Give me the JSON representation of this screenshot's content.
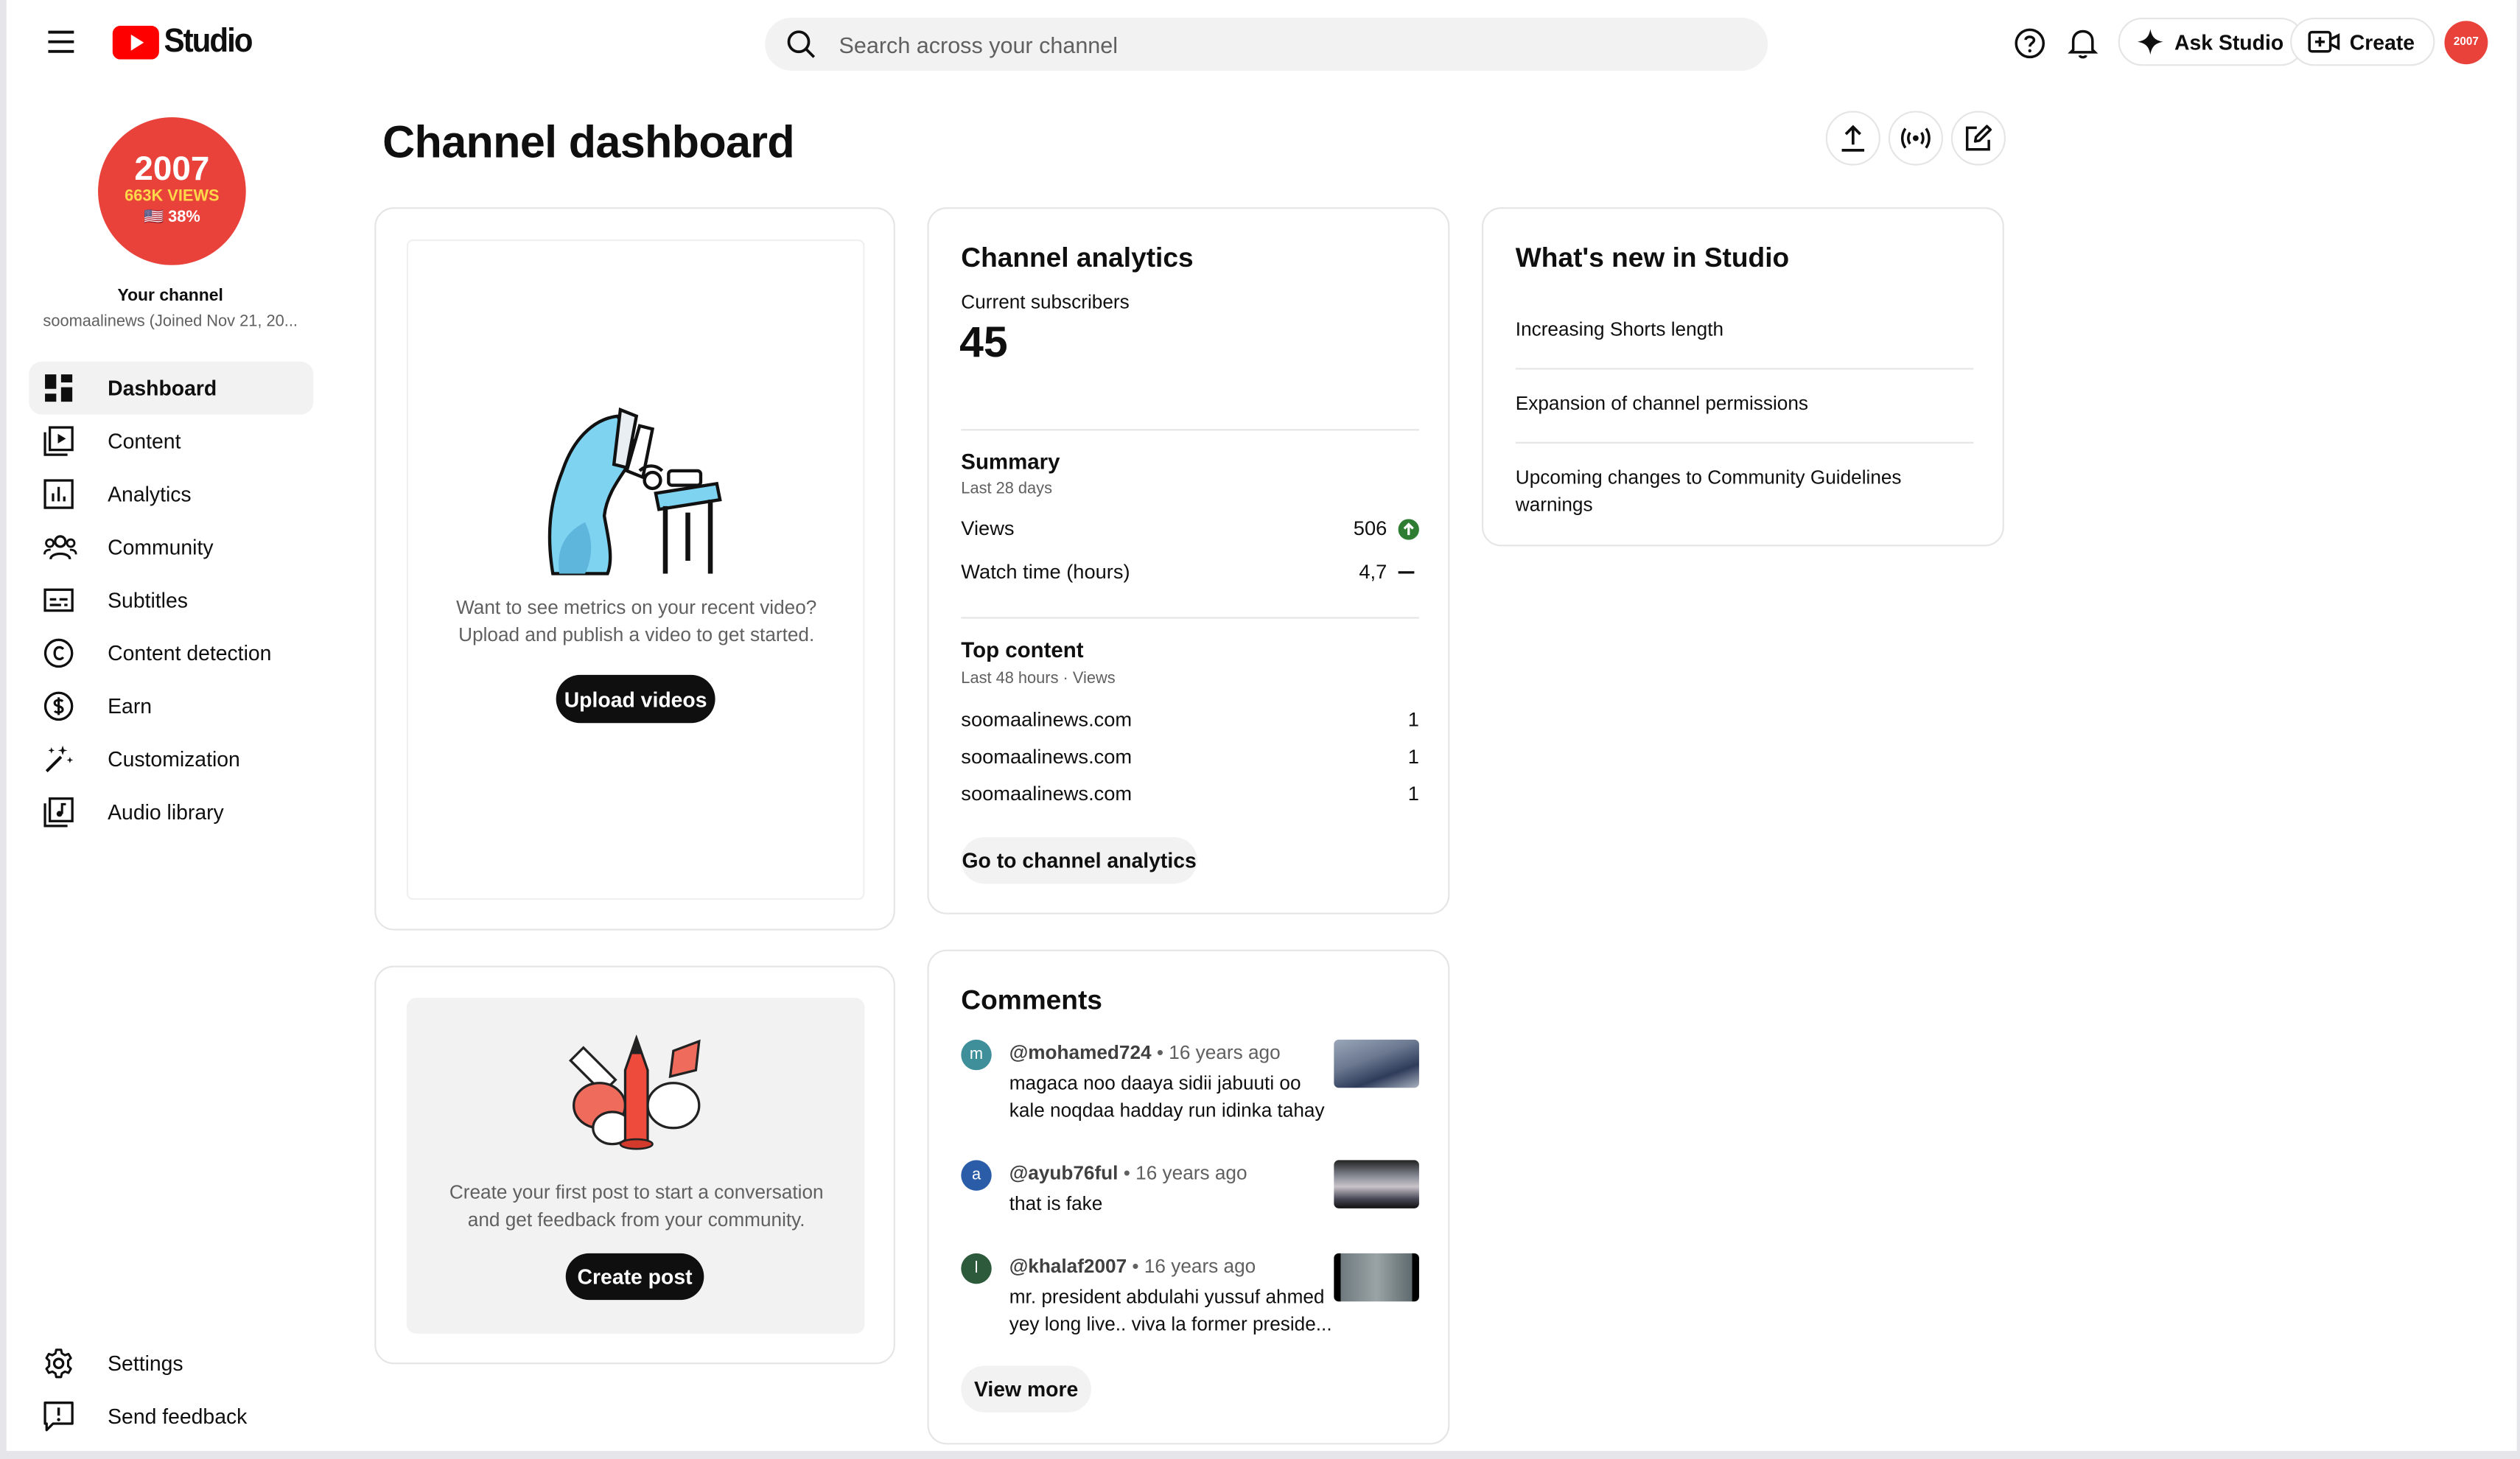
{
  "header": {
    "logo_text": "Studio",
    "search_placeholder": "Search across your channel",
    "ask_studio_label": "Ask Studio",
    "create_label": "Create",
    "avatar_text": "2007"
  },
  "channel": {
    "avatar_big_text": "2007",
    "avatar_views_text": "663K VIEWS",
    "avatar_percent_text": "🇺🇸 38%",
    "your_channel_label": "Your channel",
    "handle": "soomaalinews (Joined Nov 21, 20..."
  },
  "sidebar": {
    "items": [
      {
        "label": "Dashboard"
      },
      {
        "label": "Content"
      },
      {
        "label": "Analytics"
      },
      {
        "label": "Community"
      },
      {
        "label": "Subtitles"
      },
      {
        "label": "Content detection"
      },
      {
        "label": "Earn"
      },
      {
        "label": "Customization"
      },
      {
        "label": "Audio library"
      }
    ],
    "settings_label": "Settings",
    "feedback_label": "Send feedback"
  },
  "page": {
    "title": "Channel dashboard"
  },
  "upload_card": {
    "message_line1": "Want to see metrics on your recent video?",
    "message_line2": "Upload and publish a video to get started.",
    "button_label": "Upload videos"
  },
  "post_card": {
    "message_line1": "Create your first post to start a conversation",
    "message_line2": "and get feedback from your community.",
    "button_label": "Create post"
  },
  "analytics": {
    "title": "Channel analytics",
    "subscribers_label": "Current subscribers",
    "subscribers_value": "45",
    "summary_title": "Summary",
    "summary_period": "Last 28 days",
    "views_label": "Views",
    "views_value": "506",
    "watch_label": "Watch time (hours)",
    "watch_value": "4,7",
    "top_title": "Top content",
    "top_period": "Last 48 hours · Views",
    "top_items": [
      {
        "name": "soomaalinews.com",
        "value": "1"
      },
      {
        "name": "soomaalinews.com",
        "value": "1"
      },
      {
        "name": "soomaalinews.com",
        "value": "1"
      }
    ],
    "button_label": "Go to channel analytics"
  },
  "comments": {
    "title": "Comments",
    "items": [
      {
        "initial": "m",
        "color": "#3f8f9a",
        "user": "@mohamed724",
        "time": "• 16 years ago",
        "line1": "magaca noo daaya sidii jabuuti oo",
        "line2": "kale noqdaa hadday run idinka tahay"
      },
      {
        "initial": "a",
        "color": "#2a5ca8",
        "user": "@ayub76ful",
        "time": "• 16 years ago",
        "line1": "that is fake",
        "line2": ""
      },
      {
        "initial": "l",
        "color": "#2c5a3a",
        "user": "@khalaf2007",
        "time": "• 16 years ago",
        "line1": "mr. president abdulahi yussuf ahmed",
        "line2": "yey long live.. viva la former preside..."
      }
    ],
    "button_label": "View more"
  },
  "whats_new": {
    "title": "What's new in Studio",
    "items": [
      {
        "line1": "Increasing Shorts length",
        "line2": ""
      },
      {
        "line1": "Expansion of channel permissions",
        "line2": ""
      },
      {
        "line1": "Upcoming changes to Community Guidelines",
        "line2": "warnings"
      }
    ]
  }
}
